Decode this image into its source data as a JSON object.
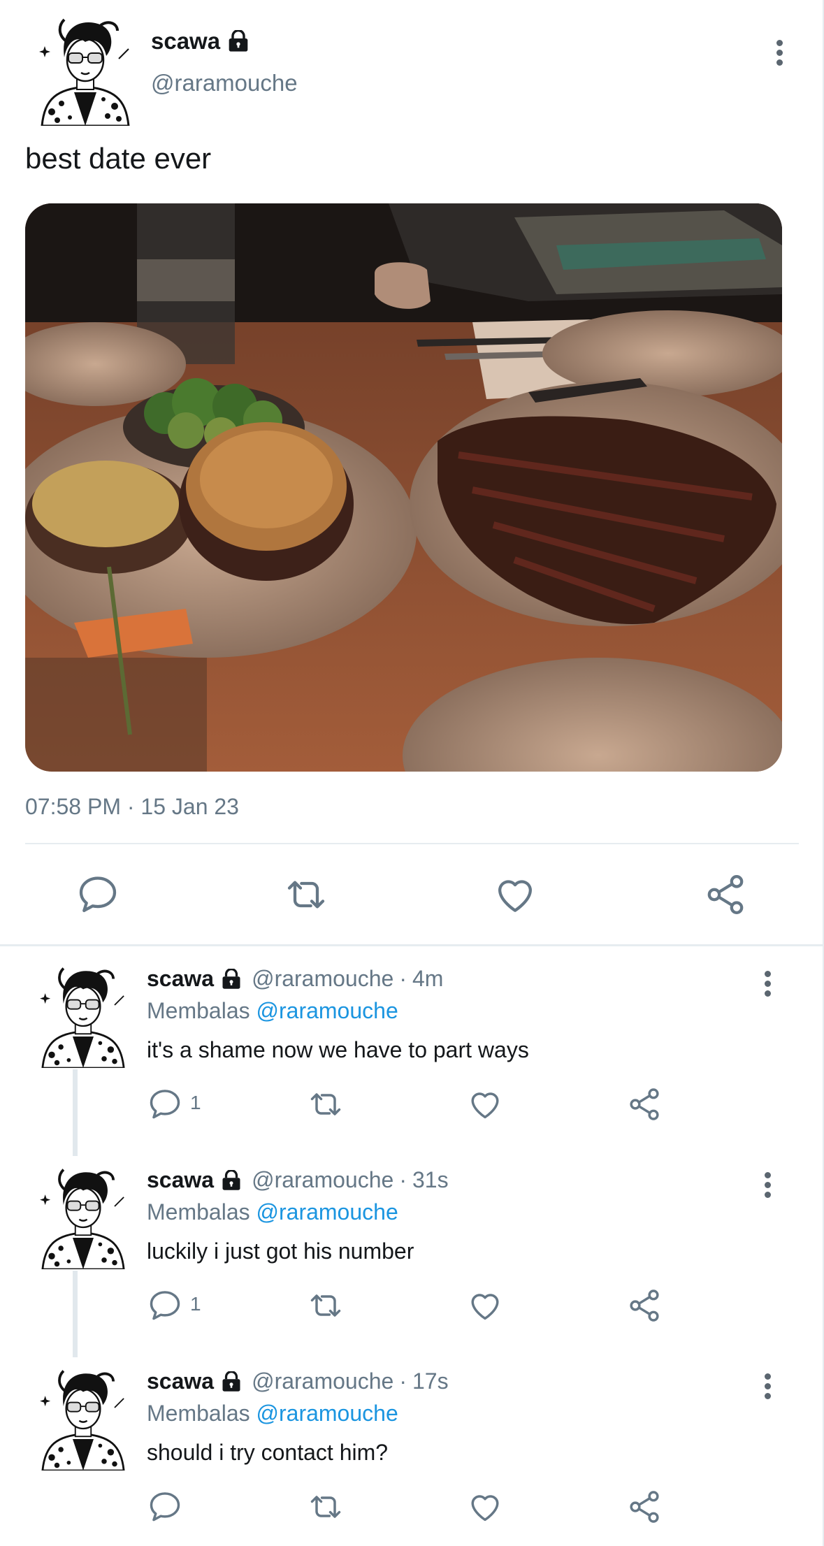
{
  "main_tweet": {
    "name": "scawa",
    "handle": "@raramouche",
    "text": "best date ever",
    "timestamp": "07:58 PM · 15 Jan 23",
    "icons": [
      "lock-icon",
      "more-icon",
      "reply-icon",
      "retweet-icon",
      "like-icon",
      "share-icon"
    ]
  },
  "replies": [
    {
      "name": "scawa",
      "handle": "@raramouche",
      "sep": "·",
      "time": "4m",
      "replying_label": "Membalas",
      "mention": "@raramouche",
      "text": "it's a shame now we have to part ways",
      "reply_count": "1"
    },
    {
      "name": "scawa",
      "handle": "@raramouche",
      "sep": "·",
      "time": "31s",
      "replying_label": "Membalas",
      "mention": "@raramouche",
      "text": "luckily i just got his number",
      "reply_count": "1"
    },
    {
      "name": "scawa",
      "handle": "@raramouche",
      "sep": "·",
      "time": "17s",
      "replying_label": "Membalas",
      "mention": "@raramouche",
      "text": "should i try contact him?",
      "reply_count": ""
    }
  ],
  "colors": {
    "secondary_text": "#657786",
    "mention": "#1b95e0",
    "divider": "#e6ecf0",
    "icon": "#657786"
  }
}
